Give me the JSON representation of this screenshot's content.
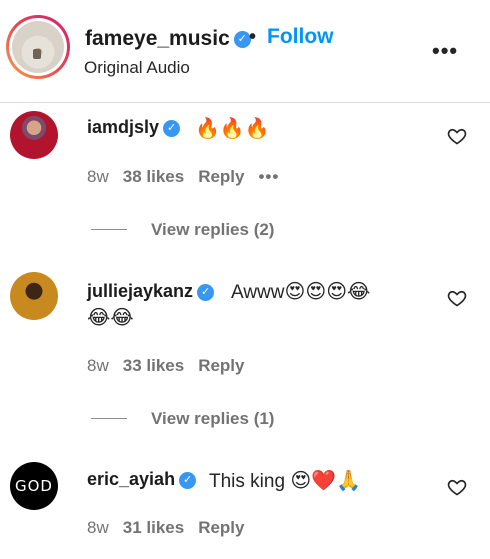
{
  "header": {
    "username": "fameye_music",
    "separator": "•",
    "follow_label": "Follow",
    "subtitle": "Original Audio",
    "more_icon": "•••"
  },
  "comments": [
    {
      "username": "iamdjsly",
      "text": "",
      "emojis": "🔥🔥🔥",
      "time": "8w",
      "likes": "38 likes",
      "reply_label": "Reply",
      "more_icon": "•••",
      "view_replies": "View replies (2)"
    },
    {
      "username": "julliejaykanz",
      "text": "Awww",
      "emojis": "😍😍😍😂",
      "emojis_line2": "😂😂",
      "time": "8w",
      "likes": "33 likes",
      "reply_label": "Reply",
      "view_replies": "View replies (1)"
    },
    {
      "username": "eric_ayiah",
      "text": "This king",
      "emojis": "😍❤️🙏",
      "avatar_text": "GOD",
      "time": "8w",
      "likes": "31 likes",
      "reply_label": "Reply"
    }
  ],
  "colors": {
    "follow": "#0095f6",
    "verified": "#3897f0",
    "meta": "#737373"
  },
  "icons": {
    "verified": "verified-badge-icon",
    "heart": "heart-outline-icon",
    "more": "more-horizontal-icon"
  }
}
